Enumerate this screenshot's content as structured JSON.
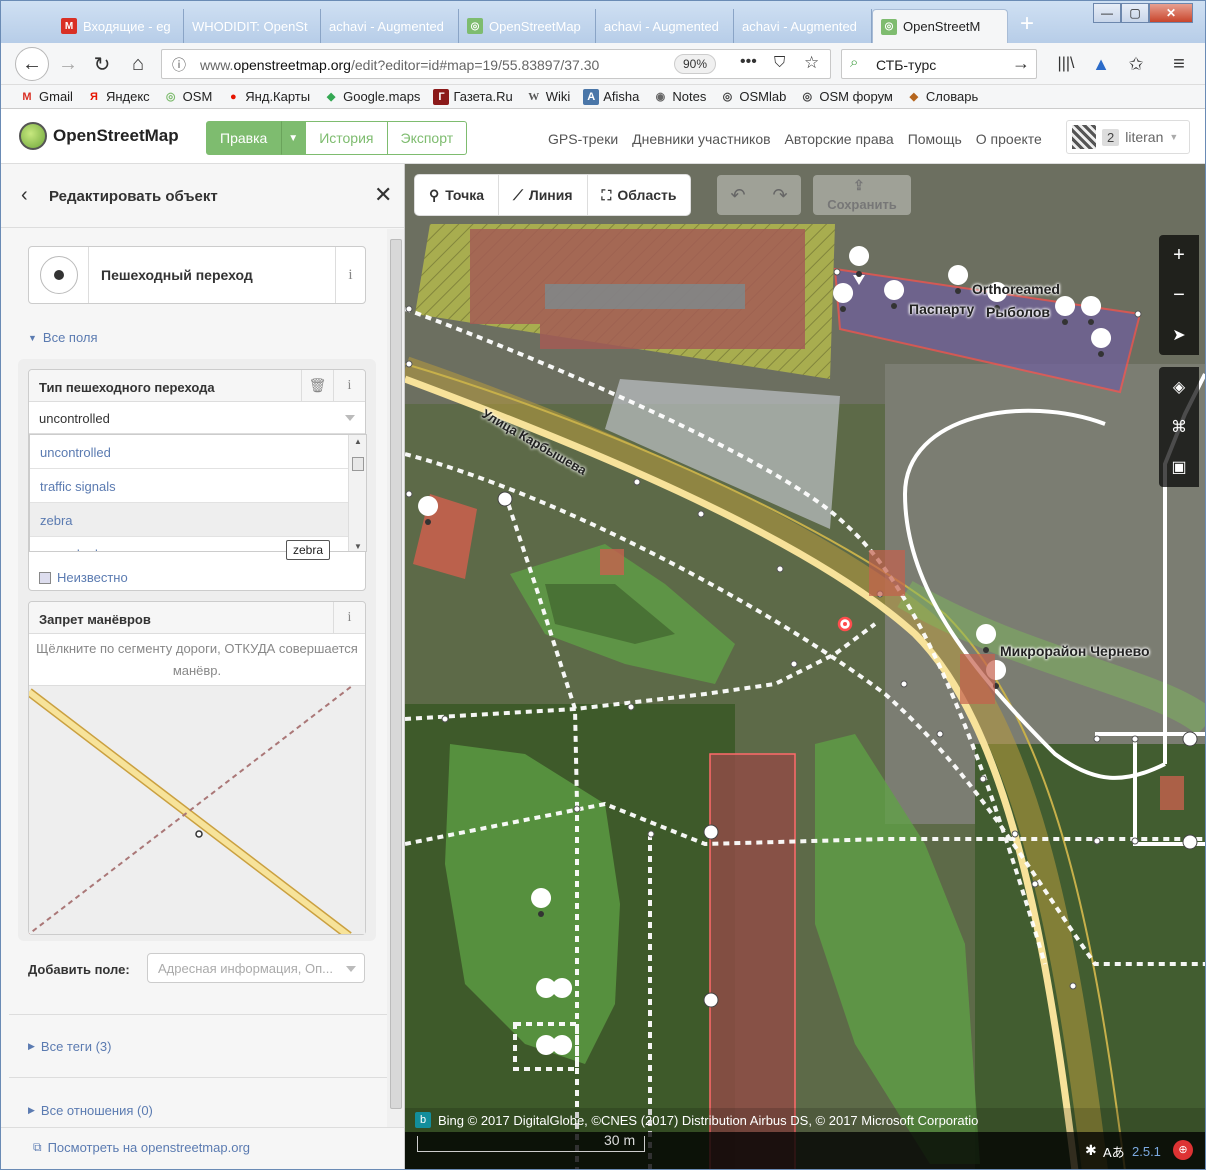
{
  "browser": {
    "tabs": [
      {
        "label": "Входящие - eg",
        "icon": "gmail-icon",
        "color": "#d93025"
      },
      {
        "label": "WHODIDIT: OpenSt",
        "icon": "none",
        "color": ""
      },
      {
        "label": "achavi - Augmented",
        "icon": "none",
        "color": ""
      },
      {
        "label": "OpenStreetMap",
        "icon": "osm-icon",
        "color": "#7ebc6f"
      },
      {
        "label": "achavi - Augmented",
        "icon": "none",
        "color": ""
      },
      {
        "label": "achavi - Augmented",
        "icon": "none",
        "color": ""
      },
      {
        "label": "OpenStreetM",
        "icon": "osm-icon",
        "color": "#7ebc6f"
      }
    ],
    "new_tab": "+",
    "url_gray": "www.",
    "url_domain": "openstreetmap.org",
    "url_rest": "/edit?editor=id#map=19/55.83897/37.30",
    "zoom": "90%",
    "search_value": "СТБ-турс",
    "bookmarks": [
      {
        "label": "Gmail",
        "icon": "M",
        "color": "#d93025"
      },
      {
        "label": "Яндекс",
        "icon": "Я",
        "color": "#e61400"
      },
      {
        "label": "OSM",
        "icon": "◎",
        "color": "#7ebc6f"
      },
      {
        "label": "Янд.Карты",
        "icon": "●",
        "color": "#e61400"
      },
      {
        "label": "Google.maps",
        "icon": "◆",
        "color": "#34a853"
      },
      {
        "label": "Газета.Ru",
        "icon": "Г",
        "color": "#8b1a1a"
      },
      {
        "label": "Wiki",
        "icon": "W",
        "color": "#555555"
      },
      {
        "label": "Afisha",
        "icon": "A",
        "color": "#4a76a8"
      },
      {
        "label": "Notes",
        "icon": "◉",
        "color": "#666666"
      },
      {
        "label": "OSMlab",
        "icon": "◎",
        "color": "#444444"
      },
      {
        "label": "OSM форум",
        "icon": "◎",
        "color": "#444444"
      },
      {
        "label": "Словарь",
        "icon": "◆",
        "color": "#b5651d"
      }
    ]
  },
  "osm": {
    "site_name": "OpenStreetMap",
    "edit_label": "Правка",
    "history_label": "История",
    "export_label": "Экспорт",
    "links": [
      "GPS-треки",
      "Дневники участников",
      "Авторские права",
      "Помощь",
      "О проекте"
    ],
    "user_count": "2",
    "user_name": "literan"
  },
  "sidebar": {
    "title": "Редактировать объект",
    "preset_name": "Пешеходный переход",
    "all_fields": "Все поля",
    "crossing_field": {
      "label": "Тип пешеходного перехода",
      "value": "uncontrolled",
      "options": [
        "uncontrolled",
        "traffic signals",
        "zebra",
        "unmarked"
      ],
      "tooltip": "zebra"
    },
    "unknown_label": "Неизвестно",
    "restrictions_field": {
      "label": "Запрет манёвров",
      "hint": "Щёлкните по сегменту дороги, ОТКУДА совершается манёвр."
    },
    "add_field_label": "Добавить поле:",
    "add_field_placeholder": "Адресная информация, Оп...",
    "all_tags": "Все теги (3)",
    "all_relations": "Все отношения (0)",
    "view_on_osm": "Посмотреть на openstreetmap.org"
  },
  "map": {
    "tools": {
      "point": "Точка",
      "line": "Линия",
      "area": "Область",
      "save": "Сохранить"
    },
    "labels": {
      "orthoreamed": "Orthoreamed",
      "pasparti": "Паспарту",
      "rybolov": "Рыболов",
      "street": "Улица Карбышева",
      "stop": "Микрорайон Чернево"
    },
    "attribution": "Bing © 2017 DigitalGlobe, ©CNES (2017) Distribution Airbus DS, © 2017 Microsoft Corporatio",
    "scale": "30 m",
    "version": "2.5.1"
  }
}
